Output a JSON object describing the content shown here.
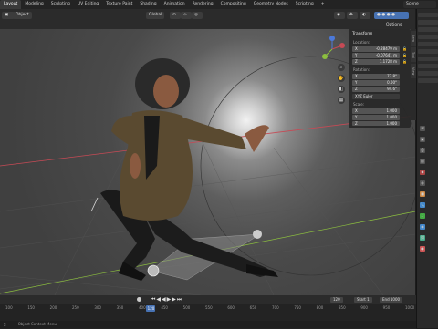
{
  "topbar": {
    "tabs": [
      "Layout",
      "Modeling",
      "Sculpting",
      "UV Editing",
      "Texture Paint",
      "Shading",
      "Animation",
      "Rendering",
      "Compositing",
      "Geometry Nodes",
      "Scripting",
      "+"
    ],
    "active_tab": "Layout",
    "scene": "Scene"
  },
  "viewport_header": {
    "object_menu": "Object",
    "orientation": "Global",
    "options": "Options"
  },
  "npanel": {
    "title": "Transform",
    "location_label": "Location:",
    "location": [
      {
        "axis": "X",
        "value": "-0.28479 m"
      },
      {
        "axis": "Y",
        "value": "-0.07641 m"
      },
      {
        "axis": "Z",
        "value": "1.1728 m"
      }
    ],
    "rotation_label": "Rotation:",
    "rotation": [
      {
        "axis": "X",
        "value": "77.8°"
      },
      {
        "axis": "Y",
        "value": "0.00°"
      },
      {
        "axis": "Z",
        "value": "94.6°"
      }
    ],
    "rotation_mode": "XYZ Euler",
    "scale_label": "Scale:",
    "scale": [
      {
        "axis": "X",
        "value": "1.000"
      },
      {
        "axis": "Y",
        "value": "1.000"
      },
      {
        "axis": "Z",
        "value": "1.000"
      }
    ]
  },
  "sidetabs": [
    "Item",
    "Tool",
    "View"
  ],
  "timeline": {
    "current_frame": "120",
    "start_label": "Start",
    "start": "1",
    "end_label": "End",
    "end": "1000",
    "ticks": [
      "100",
      "150",
      "200",
      "250",
      "300",
      "350",
      "400",
      "450",
      "500",
      "550",
      "600",
      "650",
      "700",
      "750",
      "800",
      "850",
      "900",
      "950",
      "1000"
    ],
    "playhead_frame_pct": 35.5
  },
  "statusbar": {
    "hint": "Object Context Menu"
  },
  "colors": {
    "accent": "#4772b3",
    "light_glow": "#f2f2f2",
    "x_axis": "#c64a55",
    "y_axis": "#8cbf3f",
    "z_axis": "#4c79d9"
  }
}
